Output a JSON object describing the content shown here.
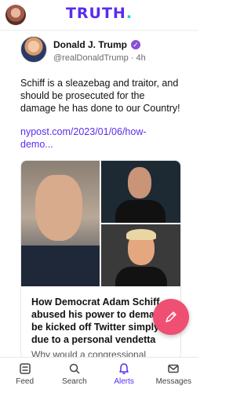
{
  "header": {
    "logo_text": "TRUTH",
    "logo_dot": "."
  },
  "post": {
    "author_name": "Donald J. Trump",
    "handle": "@realDonaldTrump",
    "separator": "·",
    "time": "4h",
    "text": "Schiff is a sleazebag and traitor, and should be prosecuted for the damage he has done to our Country!",
    "link": "nypost.com/2023/01/06/how-demo..."
  },
  "card": {
    "title": "How Democrat Adam Schiff abused his power to demand be kicked off Twitter simply due to a personal vendetta",
    "subtitle": "Why would a congressional"
  },
  "tabs": [
    {
      "label": "Feed",
      "icon": "feed-icon"
    },
    {
      "label": "Search",
      "icon": "search-icon"
    },
    {
      "label": "Alerts",
      "icon": "bell-icon"
    },
    {
      "label": "Messages",
      "icon": "mail-icon"
    }
  ],
  "colors": {
    "brand": "#5b2bf0",
    "accent_teal": "#22d3c5",
    "fab": "#ef4f72",
    "verified": "#8b4fd6"
  }
}
